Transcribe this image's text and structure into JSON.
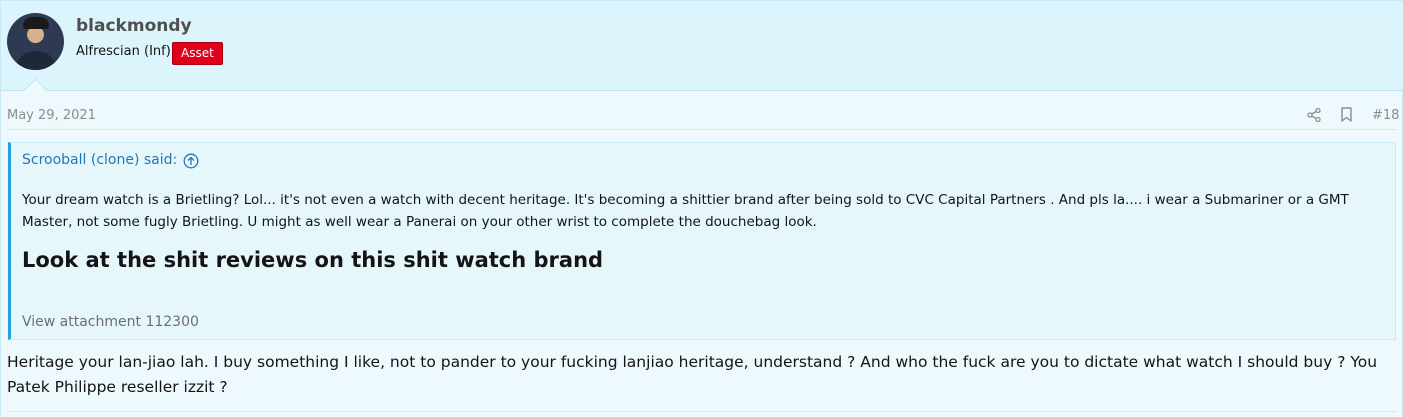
{
  "user": {
    "name": "blackmondy",
    "title": "Alfrescian (Inf)",
    "badge": "Asset",
    "avatar_icon": "user-avatar"
  },
  "post": {
    "date": "May 29, 2021",
    "number": "#18",
    "share_icon": "share-icon",
    "bookmark_icon": "bookmark-icon"
  },
  "quote": {
    "author_line": "Scrooball (clone) said:",
    "body": "Your dream watch is a Brietling? Lol... it's not even a watch with decent heritage. It's becoming a shittier brand after being sold to CVC Capital Partners . And pls la.... i wear a Submariner or a GMT Master, not some fugly Brietling. U might as well wear a Panerai on your other wrist to complete the douchebag look.",
    "heading": "Look at the shit reviews on this shit watch brand",
    "attachment": "View attachment 112300"
  },
  "reply": {
    "body": "Heritage your lan-jiao lah. I buy something I like, not to pander to your fucking lanjiao heritage, understand ? And who the fuck are you to dictate what watch I should buy ? You Patek Philippe reseller izzit ?"
  },
  "colors": {
    "user_bar_bg": "#dcf4fb",
    "page_bg": "#eef9fd",
    "quote_accent": "#2aa0d8",
    "badge_bg": "#e0001a",
    "link": "#2577b1"
  }
}
